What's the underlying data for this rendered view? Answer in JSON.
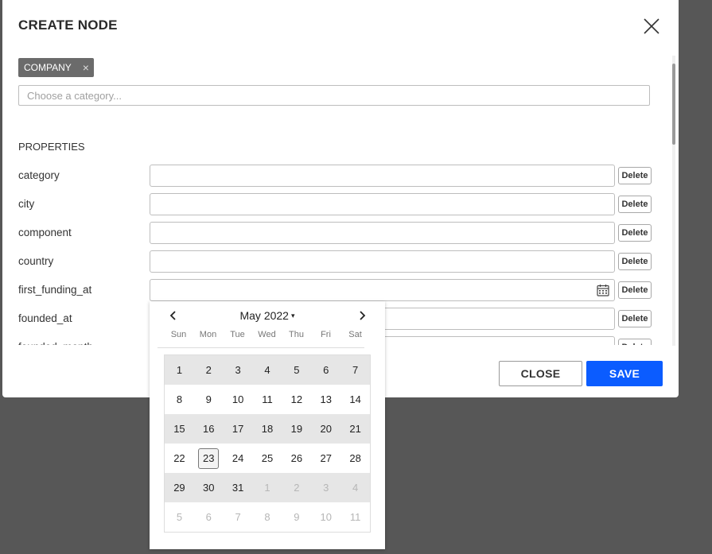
{
  "dialog": {
    "title": "CREATE NODE",
    "chip_label": "COMPANY",
    "chip_remove_glyph": "×",
    "category_placeholder": "Choose a category...",
    "properties_heading": "PROPERTIES",
    "properties": [
      {
        "label": "category",
        "value": "",
        "delete_label": "Delete"
      },
      {
        "label": "city",
        "value": "",
        "delete_label": "Delete"
      },
      {
        "label": "component",
        "value": "",
        "delete_label": "Delete"
      },
      {
        "label": "country",
        "value": "",
        "delete_label": "Delete"
      },
      {
        "label": "first_funding_at",
        "value": "",
        "delete_label": "Delete",
        "icon": "calendar-icon"
      },
      {
        "label": "founded_at",
        "value": "",
        "delete_label": "Delete"
      },
      {
        "label": "founded_month",
        "value": "",
        "delete_label": "Delete"
      }
    ],
    "close_button": "CLOSE",
    "save_button": "SAVE"
  },
  "datepicker": {
    "month_label": "May 2022",
    "caret": "▾",
    "weekdays": [
      "Sun",
      "Mon",
      "Tue",
      "Wed",
      "Thu",
      "Fri",
      "Sat"
    ],
    "weeks": [
      [
        "1",
        "2",
        "3",
        "4",
        "5",
        "6",
        "7"
      ],
      [
        "8",
        "9",
        "10",
        "11",
        "12",
        "13",
        "14"
      ],
      [
        "15",
        "16",
        "17",
        "18",
        "19",
        "20",
        "21"
      ],
      [
        "22",
        "23",
        "24",
        "25",
        "26",
        "27",
        "28"
      ],
      [
        "29",
        "30",
        "31",
        "1",
        "2",
        "3",
        "4"
      ],
      [
        "5",
        "6",
        "7",
        "8",
        "9",
        "10",
        "11"
      ]
    ],
    "today": "23"
  },
  "colors": {
    "overlay": "#575757",
    "save": "#0b5cff",
    "chip": "#6b6b6b"
  }
}
